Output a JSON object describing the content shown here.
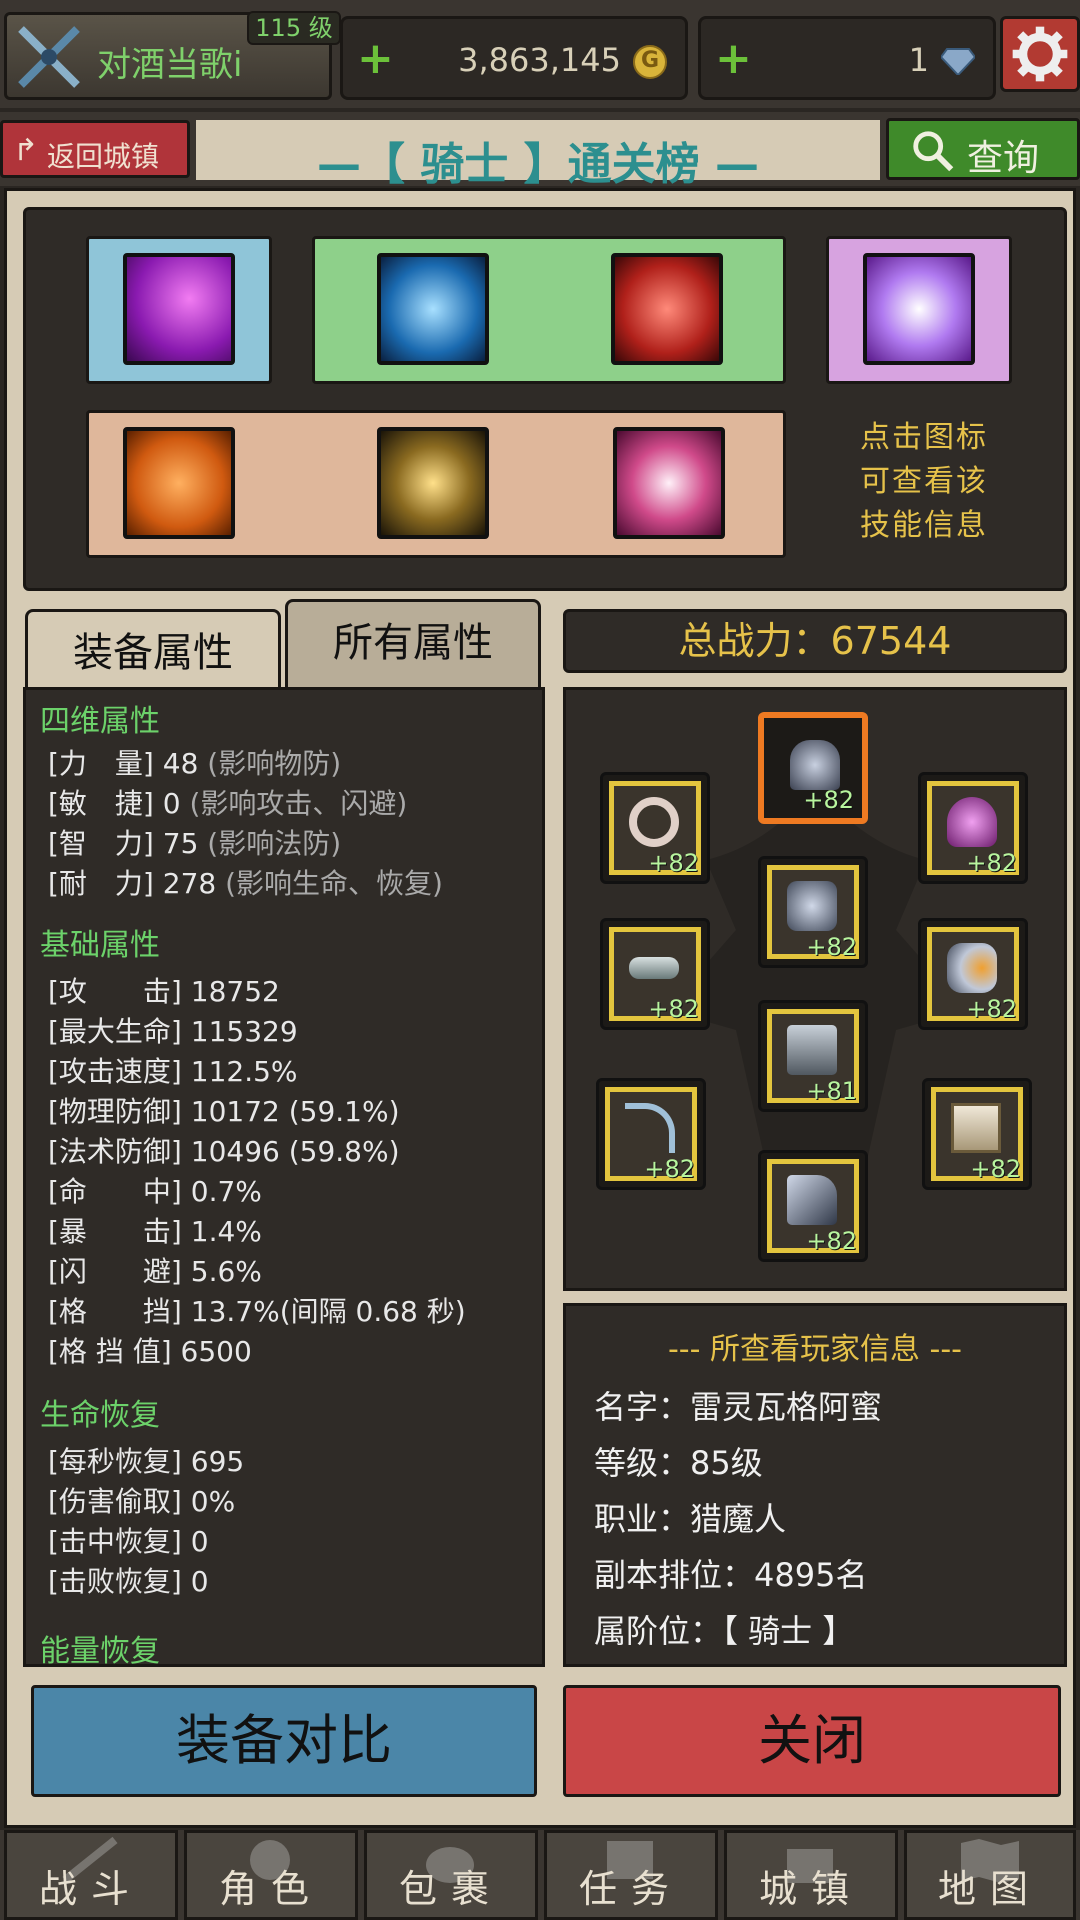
{
  "header": {
    "player_name": "对酒当歌i",
    "level": "115 级",
    "gold": "3,863,145",
    "gold_icon": "coin-icon",
    "gems": "1",
    "gem_icon": "gem-icon",
    "settings_icon": "gear-icon"
  },
  "subbar": {
    "back_label": "返回城镇",
    "title": "—【 骑士 】通关榜 —",
    "search_label": "查询"
  },
  "skills": {
    "hint_lines": [
      "点击图标",
      "可查看该",
      "技能信息"
    ]
  },
  "tabs": [
    "装备属性",
    "所有属性"
  ],
  "stats": {
    "sections": [
      {
        "title": "四维属性",
        "lines": [
          {
            "label": "[力　量] 48 ",
            "note": "(影响物防)"
          },
          {
            "label": "[敏　捷] 0 ",
            "note": "(影响攻击、闪避)"
          },
          {
            "label": "[智　力] 75 ",
            "note": "(影响法防)"
          },
          {
            "label": "[耐　力] 278 ",
            "note": "(影响生命、恢复)"
          }
        ]
      },
      {
        "title": "基础属性",
        "lines": [
          {
            "label": "[攻　　击] 18752",
            "note": ""
          },
          {
            "label": "[最大生命] 115329",
            "note": ""
          },
          {
            "label": "[攻击速度] 112.5%",
            "note": ""
          },
          {
            "label": "[物理防御] 10172 (59.1%)",
            "note": ""
          },
          {
            "label": "[法术防御] 10496 (59.8%)",
            "note": ""
          },
          {
            "label": "[命　　中] 0.7%",
            "note": ""
          },
          {
            "label": "[暴　　击] 1.4%",
            "note": ""
          },
          {
            "label": "[闪　　避] 5.6%",
            "note": ""
          },
          {
            "label": "[格　　挡] 13.7%(间隔 0.68 秒)",
            "note": ""
          },
          {
            "label": "[格 挡 值] 6500",
            "note": ""
          }
        ]
      },
      {
        "title": "生命恢复",
        "lines": [
          {
            "label": "[每秒恢复] 695",
            "note": ""
          },
          {
            "label": "[伤害偷取] 0%",
            "note": ""
          },
          {
            "label": "[击中恢复] 0",
            "note": ""
          },
          {
            "label": "[击败恢复] 0",
            "note": ""
          }
        ]
      },
      {
        "title": "能量恢复",
        "lines": []
      }
    ]
  },
  "power": "总战力：67544",
  "equipment": [
    {
      "name": "helmet",
      "level": "+82"
    },
    {
      "name": "ring",
      "level": "+82"
    },
    {
      "name": "amulet",
      "level": "+82"
    },
    {
      "name": "armor",
      "level": "+82"
    },
    {
      "name": "belt",
      "level": "+82"
    },
    {
      "name": "gloves",
      "level": "+82"
    },
    {
      "name": "pants",
      "level": "+81"
    },
    {
      "name": "bow",
      "level": "+82"
    },
    {
      "name": "shield",
      "level": "+82"
    },
    {
      "name": "boots",
      "level": "+82"
    }
  ],
  "player_info": {
    "title": "--- 所查看玩家信息 ---",
    "name": "名字：雷灵瓦格阿蜜",
    "level": "等级：85级",
    "class": "职业：猎魔人",
    "rank": "副本排位：4895名",
    "tier": "属阶位：【 骑士 】"
  },
  "buttons": {
    "compare": "装备对比",
    "close": "关闭"
  },
  "nav": [
    "战斗",
    "角色",
    "包裹",
    "任务",
    "城镇",
    "地图"
  ],
  "colors": {
    "accent_green": "#6cd26a",
    "gold_text": "#e6c24a",
    "close_red": "#c94647",
    "compare_blue": "#4b86a8"
  }
}
